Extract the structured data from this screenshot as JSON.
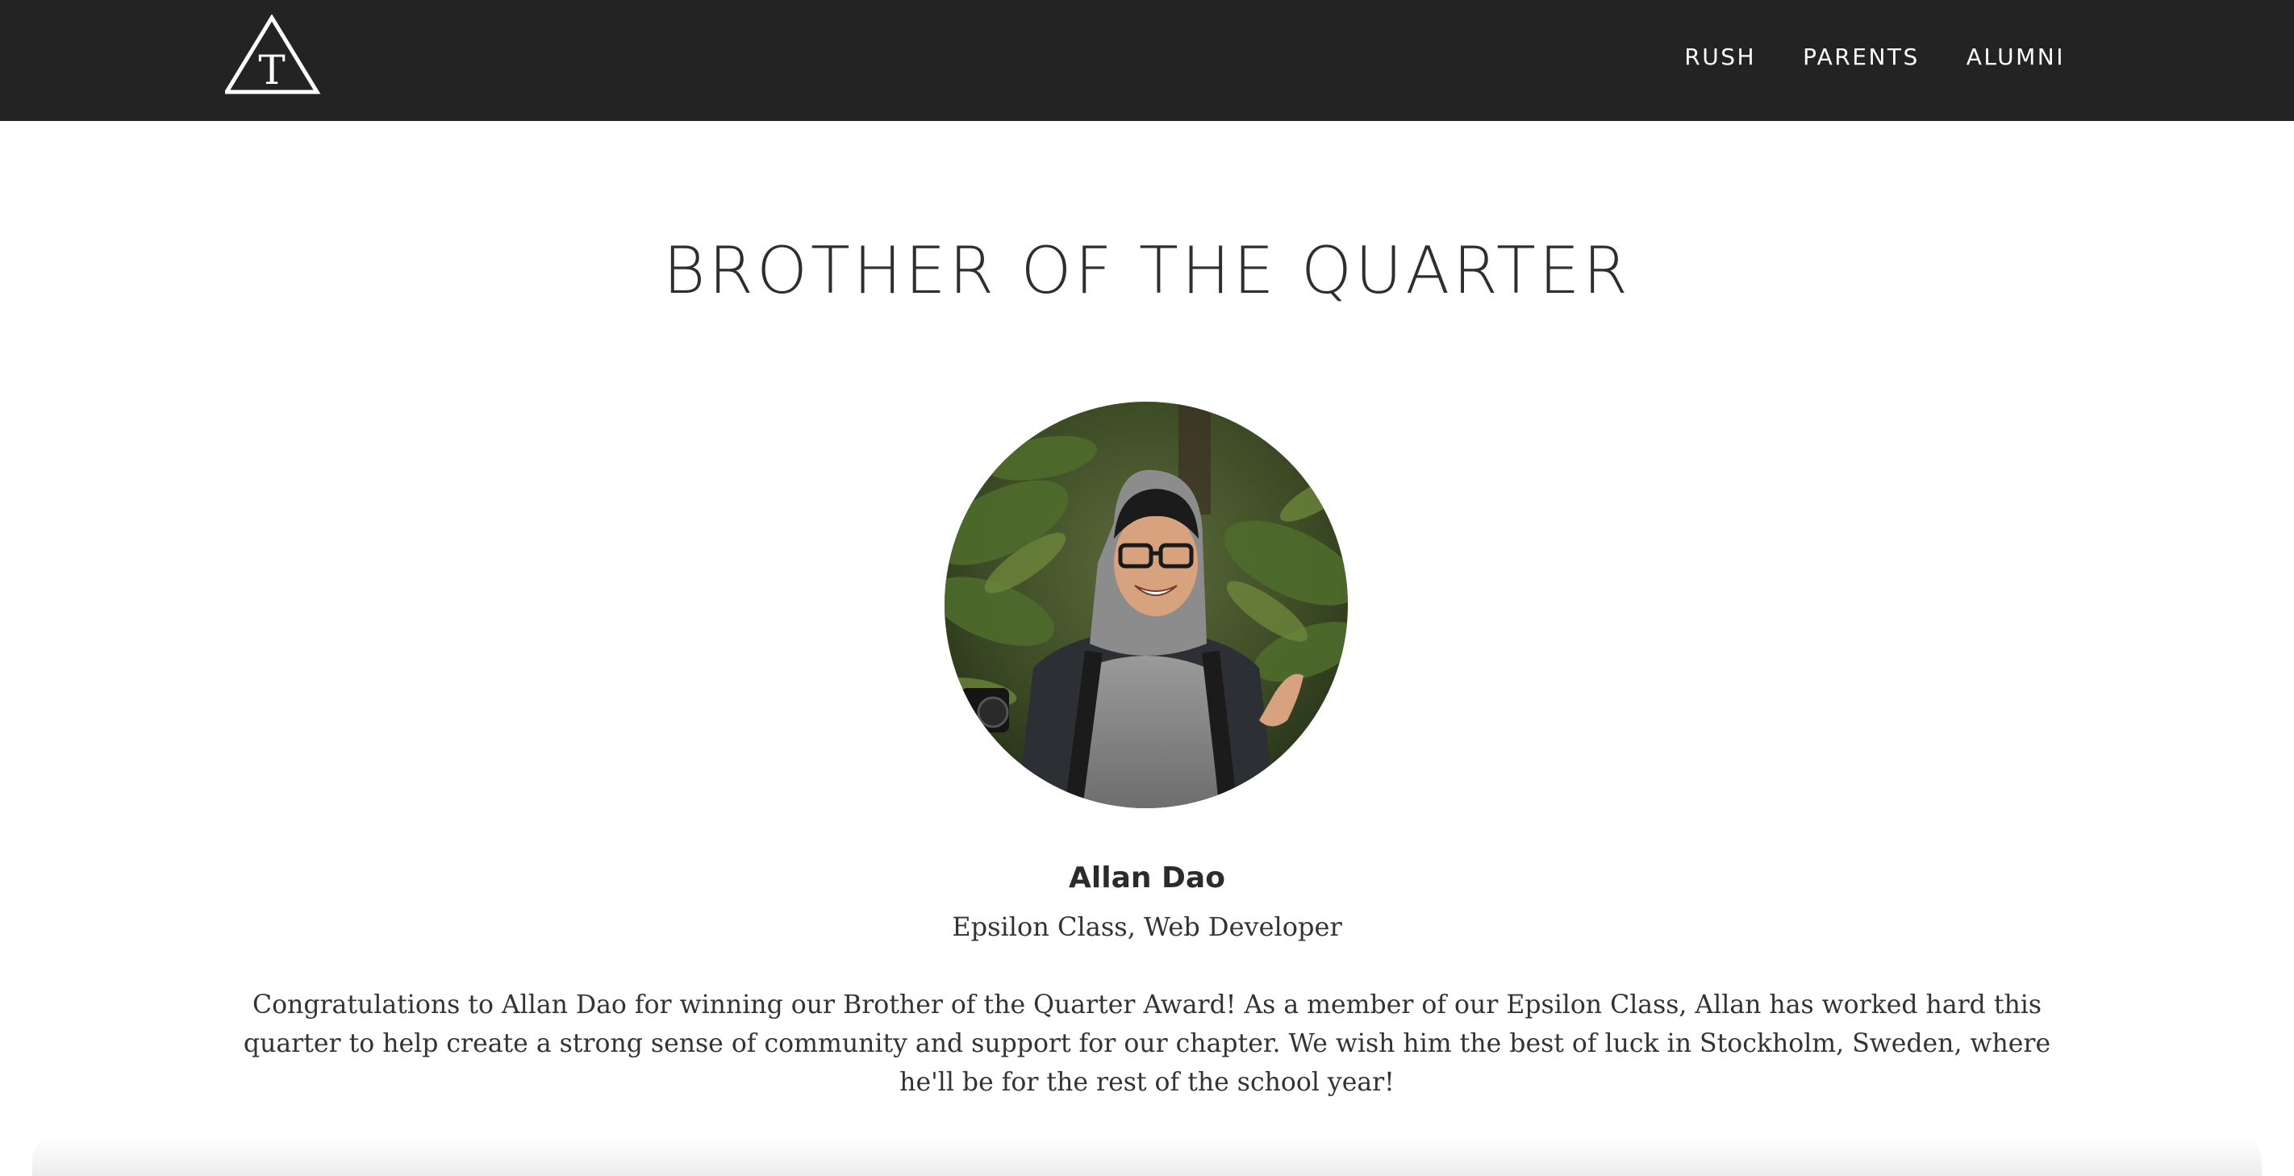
{
  "header": {
    "logo_letter": "T",
    "nav": [
      {
        "label": "RUSH"
      },
      {
        "label": "PARENTS"
      },
      {
        "label": "ALUMNI"
      }
    ]
  },
  "main": {
    "title": "BROTHER OF THE QUARTER",
    "member": {
      "name": "Allan Dao",
      "role": "Epsilon Class, Web Developer"
    },
    "description": "Congratulations to Allan Dao for winning our Brother of the Quarter Award! As a member of our Epsilon Class, Allan has worked hard this quarter to help create a strong sense of community and support for our chapter. We wish him the best of luck in Stockholm, Sweden, where he'll be for the rest of the school year!"
  },
  "colors": {
    "navbar": "#232323",
    "text": "#2b2b2b",
    "nav_text": "#ffffff"
  },
  "icons": [
    "triangle-logo-icon"
  ]
}
